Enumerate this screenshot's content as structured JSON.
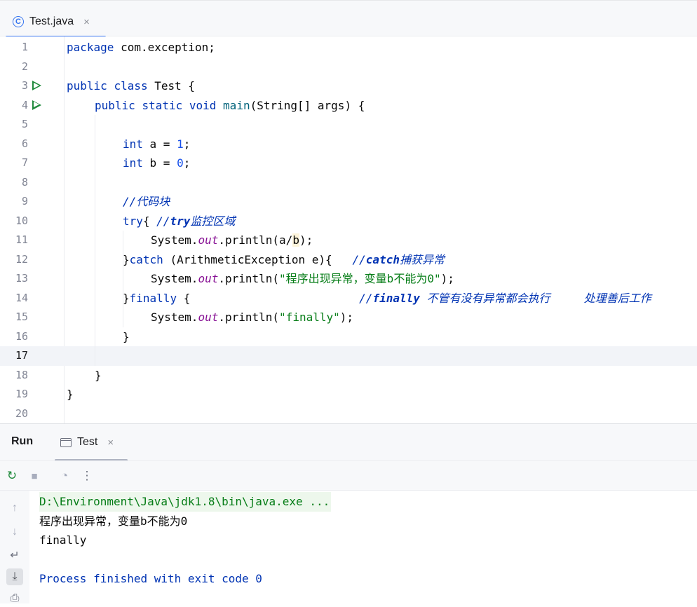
{
  "editor_tab": {
    "label": "Test.java",
    "icon": "java-class-icon",
    "icon_glyph": "C",
    "close_glyph": "×"
  },
  "editor": {
    "current_line": 17,
    "lines": [
      {
        "n": "1",
        "indent": 0,
        "tokens": [
          {
            "t": "package",
            "c": "kw"
          },
          {
            "t": " com.exception;"
          }
        ]
      },
      {
        "n": "2",
        "indent": 0,
        "tokens": []
      },
      {
        "n": "3",
        "indent": 0,
        "run": true,
        "tokens": [
          {
            "t": "public",
            "c": "kw"
          },
          {
            "t": " "
          },
          {
            "t": "class",
            "c": "kw"
          },
          {
            "t": " Test {"
          }
        ]
      },
      {
        "n": "4",
        "indent": 1,
        "run": true,
        "tokens": [
          {
            "t": "public",
            "c": "kw"
          },
          {
            "t": " "
          },
          {
            "t": "static",
            "c": "kw"
          },
          {
            "t": " "
          },
          {
            "t": "void",
            "c": "kw"
          },
          {
            "t": " "
          },
          {
            "t": "main",
            "c": "todo-none"
          },
          {
            "t": "(String[] args) {"
          }
        ]
      },
      {
        "n": "5",
        "indent": 0,
        "tokens": []
      },
      {
        "n": "6",
        "indent": 2,
        "tokens": [
          {
            "t": "int",
            "c": "kw"
          },
          {
            "t": " a = "
          },
          {
            "t": "1",
            "c": "num"
          },
          {
            "t": ";"
          }
        ]
      },
      {
        "n": "7",
        "indent": 2,
        "tokens": [
          {
            "t": "int",
            "c": "kw"
          },
          {
            "t": " b = "
          },
          {
            "t": "0",
            "c": "num"
          },
          {
            "t": ";"
          }
        ]
      },
      {
        "n": "8",
        "indent": 0,
        "tokens": []
      },
      {
        "n": "9",
        "indent": 2,
        "tokens": [
          {
            "t": "//代码块",
            "c": "cmt2"
          }
        ]
      },
      {
        "n": "10",
        "indent": 2,
        "tokens": [
          {
            "t": "try",
            "c": "kw"
          },
          {
            "t": "{ "
          },
          {
            "t": "//",
            "c": "cmt2"
          },
          {
            "t": "try",
            "c": "cmtb"
          },
          {
            "t": "监控区域",
            "c": "cmt2"
          }
        ]
      },
      {
        "n": "11",
        "indent": 3,
        "tokens": [
          {
            "t": "System."
          },
          {
            "t": "out",
            "c": "fld"
          },
          {
            "t": ".println(a/"
          },
          {
            "t": "b",
            "c": "hl-b"
          },
          {
            "t": ");"
          }
        ]
      },
      {
        "n": "12",
        "indent": 2,
        "tokens": [
          {
            "t": "}"
          },
          {
            "t": "catch",
            "c": "kw"
          },
          {
            "t": " (ArithmeticException e){   "
          },
          {
            "t": "//",
            "c": "cmt2"
          },
          {
            "t": "catch",
            "c": "cmtb"
          },
          {
            "t": "捕获异常",
            "c": "cmt2"
          }
        ]
      },
      {
        "n": "13",
        "indent": 3,
        "tokens": [
          {
            "t": "System."
          },
          {
            "t": "out",
            "c": "fld"
          },
          {
            "t": ".println("
          },
          {
            "t": "\"程序出现异常，变量b不能为0\"",
            "c": "str"
          },
          {
            "t": ");"
          }
        ]
      },
      {
        "n": "14",
        "indent": 2,
        "tokens": [
          {
            "t": "}"
          },
          {
            "t": "finally",
            "c": "kw"
          },
          {
            "t": " {                         "
          },
          {
            "t": "//",
            "c": "cmt2"
          },
          {
            "t": "finally",
            "c": "cmtb"
          },
          {
            "t": " 不管有没有异常都会执行     处理善后工作",
            "c": "cmt2"
          }
        ]
      },
      {
        "n": "15",
        "indent": 3,
        "tokens": [
          {
            "t": "System."
          },
          {
            "t": "out",
            "c": "fld"
          },
          {
            "t": ".println("
          },
          {
            "t": "\"finally\"",
            "c": "str"
          },
          {
            "t": ");"
          }
        ]
      },
      {
        "n": "16",
        "indent": 2,
        "tokens": [
          {
            "t": "}"
          }
        ]
      },
      {
        "n": "17",
        "indent": 0,
        "tokens": []
      },
      {
        "n": "18",
        "indent": 1,
        "tokens": [
          {
            "t": "}"
          }
        ]
      },
      {
        "n": "19",
        "indent": 0,
        "tokens": [
          {
            "t": "}"
          }
        ]
      },
      {
        "n": "20",
        "indent": 0,
        "tokens": []
      }
    ]
  },
  "run_panel": {
    "title": "Run",
    "tab_label": "Test",
    "close_glyph": "×",
    "toolbar": [
      {
        "name": "rerun-icon",
        "glyph": "↻"
      },
      {
        "name": "stop-icon",
        "glyph": "■"
      },
      {
        "name": "profiler-icon",
        "glyph": "◔"
      },
      {
        "name": "more-options-icon",
        "glyph": "⋮"
      }
    ],
    "side_toolbar": [
      {
        "name": "scroll-up-icon",
        "glyph": "↑"
      },
      {
        "name": "scroll-down-icon",
        "glyph": "↓"
      },
      {
        "name": "soft-wrap-icon",
        "glyph": "↵"
      },
      {
        "name": "scroll-to-end-icon",
        "glyph": "⤓"
      },
      {
        "name": "print-icon",
        "glyph": "⎙"
      }
    ]
  },
  "console": {
    "command": "D:\\Environment\\Java\\jdk1.8\\bin\\java.exe ...",
    "output_lines": [
      "程序出现异常，变量b不能为0",
      "finally"
    ],
    "exit_message": "Process finished with exit code 0"
  },
  "colors": {
    "accent": "#3574f0",
    "keyword": "#0033b3",
    "string": "#067d17",
    "number": "#1750eb",
    "field": "#871094",
    "run_gutter": "#208a3c"
  }
}
